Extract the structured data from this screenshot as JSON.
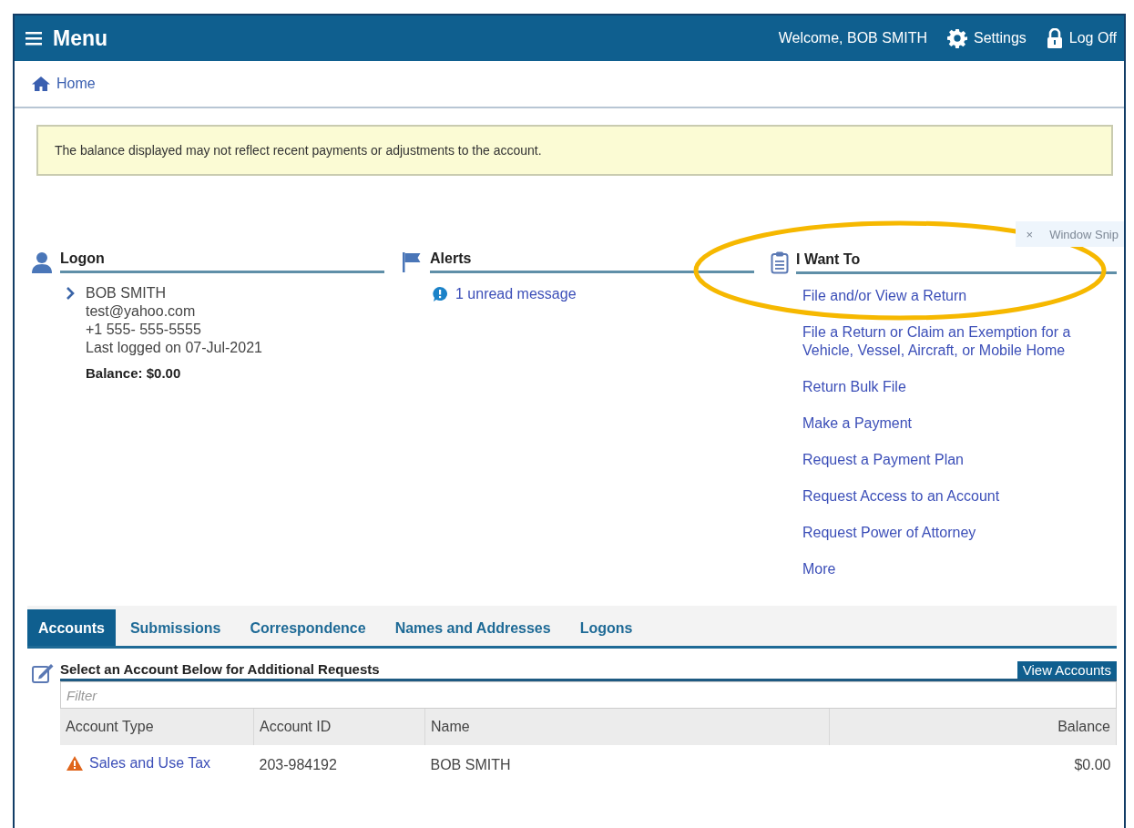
{
  "header": {
    "menu_label": "Menu",
    "welcome": "Welcome, BOB SMITH",
    "settings": "Settings",
    "logoff": "Log Off"
  },
  "breadcrumb": {
    "home": "Home"
  },
  "notice": "The balance displayed may not reflect recent payments or adjustments to the account.",
  "snip_toolbar": {
    "close": "×",
    "label": "Window Snip"
  },
  "logon": {
    "title": "Logon",
    "name": "BOB SMITH",
    "email": "test@yahoo.com",
    "phone": "+1 555- 555-5555",
    "last_logged": "Last logged on 07-Jul-2021",
    "balance": "Balance: $0.00"
  },
  "alerts": {
    "title": "Alerts",
    "message": "1 unread message"
  },
  "i_want_to": {
    "title": "I Want To",
    "links": [
      "File and/or View a Return",
      "File a Return or Claim an Exemption for a Vehicle, Vessel, Aircraft, or Mobile Home",
      "Return Bulk File",
      "Make a Payment",
      "Request a Payment Plan",
      "Request Access to an Account",
      "Request Power of Attorney",
      "More"
    ]
  },
  "tabs": [
    {
      "label": "Accounts",
      "selected": true
    },
    {
      "label": "Submissions",
      "selected": false
    },
    {
      "label": "Correspondence",
      "selected": false
    },
    {
      "label": "Names and Addresses",
      "selected": false
    },
    {
      "label": "Logons",
      "selected": false
    }
  ],
  "accounts": {
    "title": "Select an Account Below for Additional Requests",
    "view_button": "View Accounts",
    "filter": {
      "placeholder": "Filter"
    },
    "columns": [
      "Account Type",
      "Account ID",
      "Name",
      "Balance"
    ],
    "rows": [
      {
        "type": "Sales and Use Tax",
        "warning": true,
        "id": "203-984192",
        "name": "BOB SMITH",
        "balance": "$0.00"
      }
    ]
  }
}
